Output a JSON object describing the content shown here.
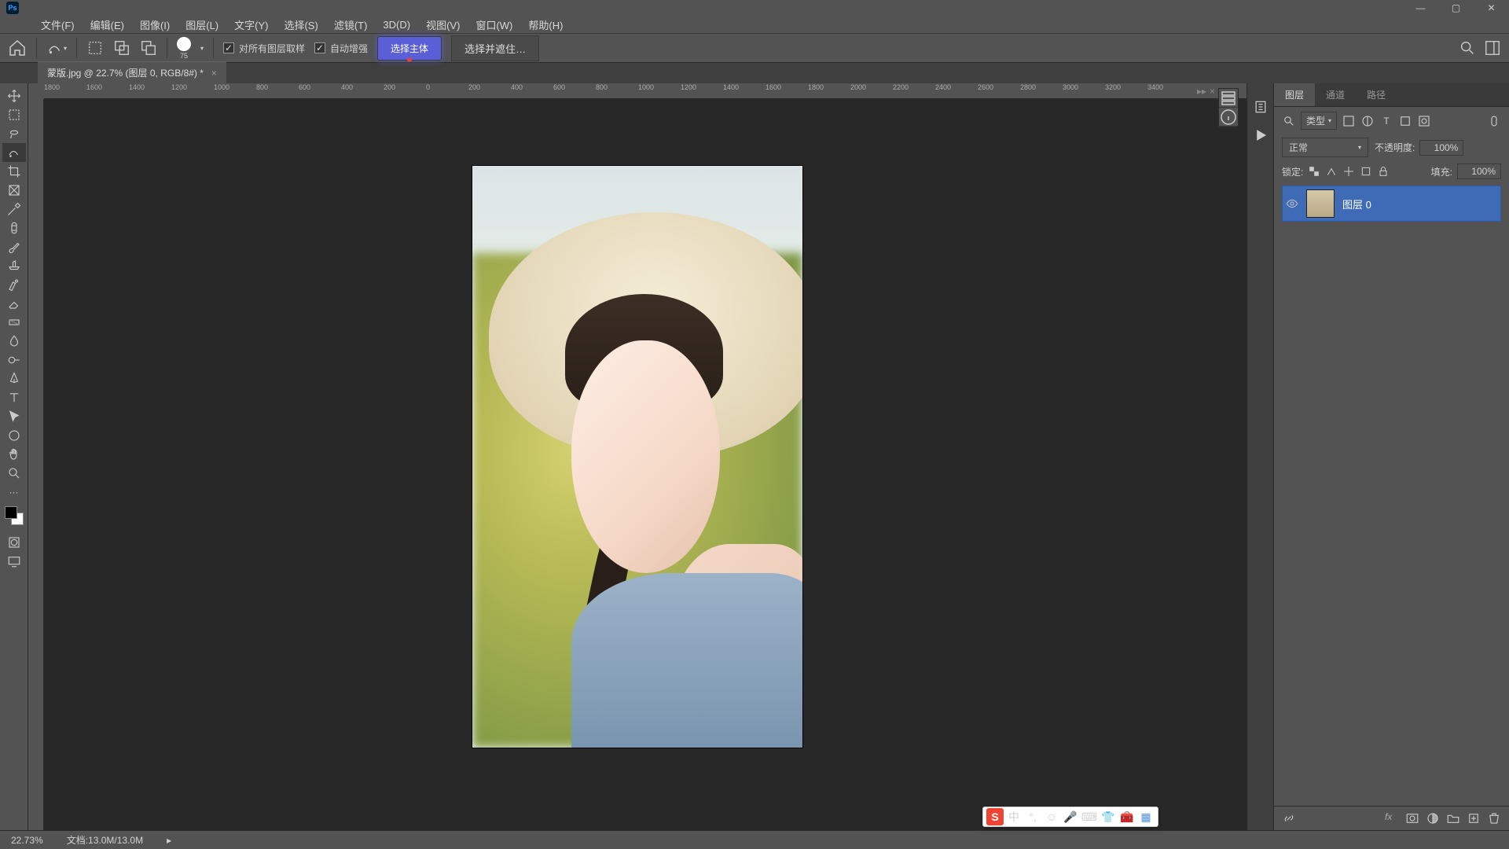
{
  "menubar": [
    "文件(F)",
    "编辑(E)",
    "图像(I)",
    "图层(L)",
    "文字(Y)",
    "选择(S)",
    "滤镜(T)",
    "3D(D)",
    "视图(V)",
    "窗口(W)",
    "帮助(H)"
  ],
  "options": {
    "brush_size": "75",
    "sample_all": "对所有图层取样",
    "auto_enhance": "自动增强",
    "select_subject": "选择主体",
    "select_mask": "选择并遮住…"
  },
  "doc_tab": "蒙版.jpg @ 22.7% (图层 0, RGB/8#) *",
  "ruler_h": [
    "1800",
    "1600",
    "1400",
    "1200",
    "1000",
    "800",
    "600",
    "400",
    "200",
    "0",
    "200",
    "400",
    "600",
    "800",
    "1000",
    "1200",
    "1400",
    "1600",
    "1800",
    "2000",
    "2200",
    "2400",
    "2600",
    "2800",
    "3000",
    "3200",
    "3400"
  ],
  "panels": {
    "tabs": [
      "图层",
      "通道",
      "路径"
    ],
    "filter_label": "类型",
    "blend_mode": "正常",
    "opacity_label": "不透明度:",
    "opacity_value": "100%",
    "lock_label": "锁定:",
    "fill_label": "填充:",
    "fill_value": "100%",
    "layer0_name": "图层 0"
  },
  "status": {
    "zoom": "22.73%",
    "docinfo": "文档:13.0M/13.0M"
  },
  "ime_lang": "中"
}
